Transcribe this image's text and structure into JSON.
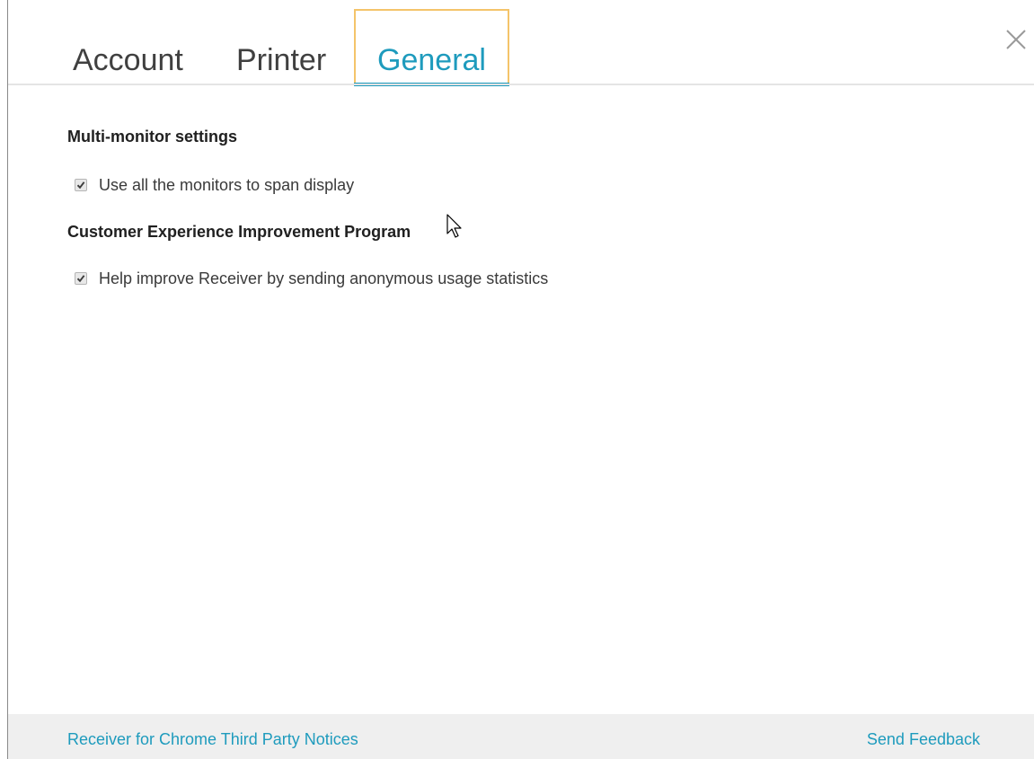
{
  "tabs": {
    "account": "Account",
    "printer": "Printer",
    "general": "General",
    "active": "general"
  },
  "close": {
    "icon": "close-icon"
  },
  "sections": {
    "multi_monitor": {
      "title": "Multi-monitor settings",
      "option_label": "Use all the monitors to span display",
      "checked": true
    },
    "ceip": {
      "title": "Customer Experience Improvement Program",
      "option_label": "Help improve Receiver by sending anonymous usage statistics",
      "checked": true
    }
  },
  "footer": {
    "notices_link": "Receiver for Chrome Third Party Notices",
    "feedback_link": "Send Feedback"
  },
  "colors": {
    "accent": "#1e9bbd",
    "focus_outline": "#f4c46a",
    "footer_bg": "#efefef"
  }
}
